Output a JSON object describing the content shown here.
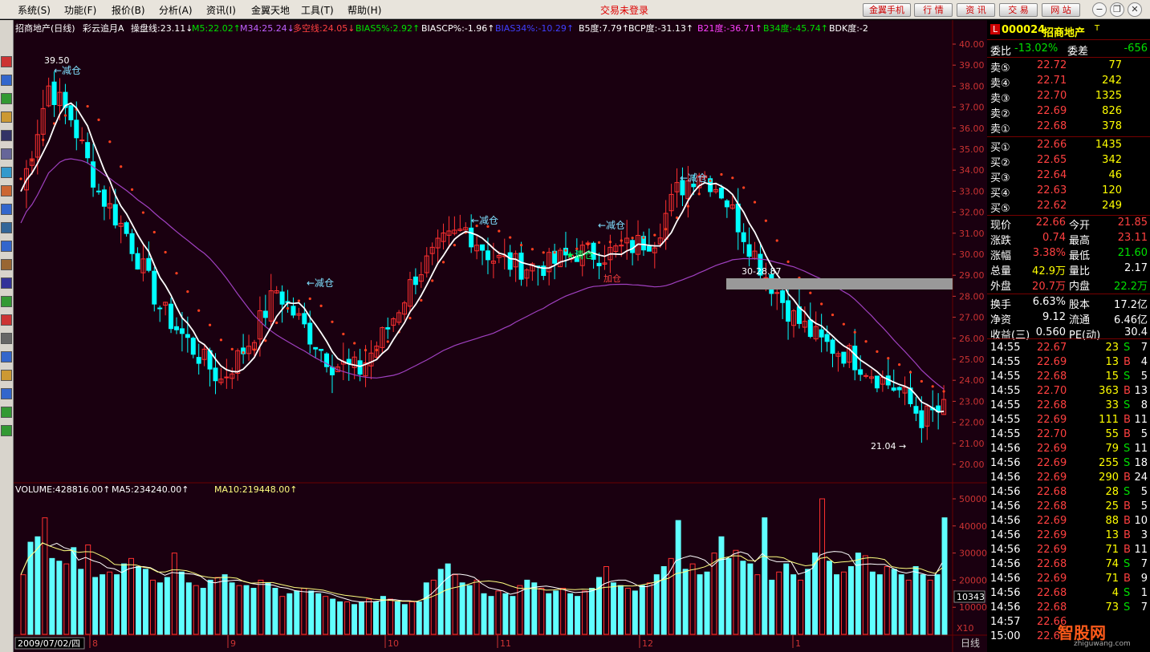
{
  "menu": [
    "系统(S)",
    "功能(F)",
    "报价(B)",
    "分析(A)",
    "资讯(I)",
    "金翼天地",
    "工具(T)",
    "帮助(H)"
  ],
  "status": "交易未登录",
  "top_buttons": [
    "金翼手机",
    "行 情",
    "资 讯",
    "交 易",
    "网 站"
  ],
  "window_buttons": [
    "minimize-icon",
    "restore-icon",
    "close-icon"
  ],
  "toolbar_icons": [
    "chart-icon",
    "grid-icon",
    "line-icon",
    "bar-icon",
    "list-icon",
    "table-icon",
    "info-icon",
    "user-icon",
    "f10-icon",
    "search-icon",
    "ie-icon",
    "draw-icon",
    "si-icon",
    "money-icon",
    "dollar-icon",
    "wrench-icon",
    "zoom-icon",
    "pencil-icon",
    "move-icon",
    "up-arrow-icon",
    "down-arrow-icon"
  ],
  "indicator_bar": [
    {
      "text": "招商地产(日线)",
      "color": "#ffffff"
    },
    {
      "text": "彩云追月A",
      "color": "#ffffff"
    },
    {
      "text": "操盘线:23.11↓",
      "color": "#ffffff"
    },
    {
      "text": "M5:22.02↑",
      "color": "#00e000"
    },
    {
      "text": "M34:25.24↓",
      "color": "#c060ff"
    },
    {
      "text": "多空线:24.05↓",
      "color": "#ff4040"
    },
    {
      "text": "BIAS5%:2.92↑",
      "color": "#00e000"
    },
    {
      "text": "BIASCP%:-1.96↑",
      "color": "#ffffff"
    },
    {
      "text": "BIAS34%:-10.29↑",
      "color": "#4040ff"
    },
    {
      "text": "B5度:7.79↑",
      "color": "#ffffff"
    },
    {
      "text": "BCP度:-31.13↑",
      "color": "#ffffff"
    },
    {
      "text": "B21度:-36.71↑",
      "color": "#ff40ff"
    },
    {
      "text": "B34度:-45.74↑",
      "color": "#00e000"
    },
    {
      "text": "BDK度:-2",
      "color": "#ffffff"
    }
  ],
  "price_labels": {
    "high": "39.50",
    "low": "21.04",
    "marker": "30-28.87",
    "reduce": "←减仓",
    "reduce_alt": "减仓",
    "clear": "清仓",
    "add": "加仓"
  },
  "volume_bar": [
    {
      "text": "VOLUME:428816.00↑",
      "color": "#ffffff"
    },
    {
      "text": "MA5:234240.00↑",
      "color": "#ffffff"
    },
    {
      "text": "MA10:219448.00↑",
      "color": "#ffff80"
    }
  ],
  "volume_marker": "10343",
  "volume_unit": "X10",
  "period": "日线",
  "date_box": "2009/07/02/四",
  "months": [
    "8",
    "9",
    "10",
    "11",
    "12",
    "1"
  ],
  "chart_data": {
    "type": "candlestick",
    "price_axis": {
      "ticks": [
        "40.00",
        "39.00",
        "38.00",
        "37.00",
        "36.00",
        "35.00",
        "34.00",
        "33.00",
        "32.00",
        "31.00",
        "30.00",
        "29.00",
        "28.00",
        "27.00",
        "26.00",
        "25.00",
        "24.00",
        "23.00",
        "22.00",
        "21.00",
        "20.00"
      ],
      "ylim": [
        20,
        40
      ]
    },
    "volume_axis": {
      "ticks": [
        "50000",
        "40000",
        "30000",
        "20000",
        "10000"
      ],
      "ylim": [
        0,
        50000
      ]
    },
    "volume_series": [
      22000,
      34000,
      36000,
      43000,
      28000,
      27000,
      26000,
      32000,
      24000,
      33000,
      21000,
      22000,
      23000,
      22000,
      26000,
      28000,
      25000,
      24000,
      20000,
      19000,
      21000,
      30000,
      23000,
      19000,
      18000,
      17000,
      20000,
      21000,
      22000,
      19000,
      18000,
      18000,
      17000,
      20000,
      19000,
      17000,
      14000,
      15000,
      16000,
      17000,
      16000,
      15000,
      14000,
      13000,
      12000,
      12000,
      11000,
      12000,
      13000,
      12000,
      14000,
      13000,
      12000,
      11000,
      12000,
      12000,
      19000,
      20000,
      24000,
      26000,
      22000,
      19000,
      18000,
      20000,
      15000,
      14000,
      16000,
      15000,
      14000,
      18000,
      20000,
      19000,
      17000,
      15000,
      16000,
      17000,
      15000,
      14000,
      16000,
      17000,
      21000,
      25000,
      19000,
      18000,
      17000,
      16000,
      18000,
      19000,
      22000,
      25000,
      28000,
      42000,
      24000,
      26000,
      22000,
      23000,
      30000,
      36000,
      28000,
      31000,
      27000,
      26000,
      22000,
      43000,
      20000,
      23000,
      26000,
      22000,
      20000,
      24000,
      30000,
      50000,
      27000,
      22000,
      23000,
      25000,
      30000,
      29000,
      23000,
      22000,
      25000,
      24000,
      22000,
      20000,
      25000,
      22000,
      20000,
      22000,
      43000
    ]
  },
  "quote": {
    "code": "000024",
    "name": "招商地产",
    "flag": "L",
    "tag": "T",
    "weibi_label": "委比",
    "weibi": "-13.02%",
    "weicha_label": "委差",
    "weicha": "-656",
    "asks": [
      {
        "label": "卖⑤",
        "price": "22.72",
        "vol": "77"
      },
      {
        "label": "卖④",
        "price": "22.71",
        "vol": "242"
      },
      {
        "label": "卖③",
        "price": "22.70",
        "vol": "1325"
      },
      {
        "label": "卖②",
        "price": "22.69",
        "vol": "826"
      },
      {
        "label": "卖①",
        "price": "22.68",
        "vol": "378"
      }
    ],
    "bids": [
      {
        "label": "买①",
        "price": "22.66",
        "vol": "1435"
      },
      {
        "label": "买②",
        "price": "22.65",
        "vol": "342"
      },
      {
        "label": "买③",
        "price": "22.64",
        "vol": "46"
      },
      {
        "label": "买④",
        "price": "22.63",
        "vol": "120"
      },
      {
        "label": "买⑤",
        "price": "22.62",
        "vol": "249"
      }
    ],
    "stats": [
      {
        "l1": "现价",
        "v1": "22.66",
        "c1": "#ff4040",
        "l2": "今开",
        "v2": "21.85",
        "c2": "#ff4040"
      },
      {
        "l1": "涨跌",
        "v1": "0.74",
        "c1": "#ff4040",
        "l2": "最高",
        "v2": "23.11",
        "c2": "#ff4040"
      },
      {
        "l1": "涨幅",
        "v1": "3.38%",
        "c1": "#ff4040",
        "l2": "最低",
        "v2": "21.60",
        "c2": "#00e000"
      },
      {
        "l1": "总量",
        "v1": "42.9万",
        "c1": "#ffff00",
        "l2": "量比",
        "v2": "2.17",
        "c2": "#ffffff"
      },
      {
        "l1": "外盘",
        "v1": "20.7万",
        "c1": "#ff4040",
        "l2": "内盘",
        "v2": "22.2万",
        "c2": "#00e000"
      },
      {
        "l1": "换手",
        "v1": "6.63%",
        "c1": "#ffffff",
        "l2": "股本",
        "v2": "17.2亿",
        "c2": "#ffffff"
      },
      {
        "l1": "净资",
        "v1": "9.12",
        "c1": "#ffffff",
        "l2": "流通",
        "v2": "6.46亿",
        "c2": "#ffffff"
      },
      {
        "l1": "收益(三)",
        "v1": "0.560",
        "c1": "#ffffff",
        "l2": "PE(动)",
        "v2": "30.4",
        "c2": "#ffffff"
      }
    ],
    "ticks": [
      {
        "t": "14:55",
        "p": "22.67",
        "v": "23",
        "s": "S",
        "n": "7"
      },
      {
        "t": "14:55",
        "p": "22.69",
        "v": "13",
        "s": "B",
        "n": "4"
      },
      {
        "t": "14:55",
        "p": "22.68",
        "v": "15",
        "s": "S",
        "n": "5"
      },
      {
        "t": "14:55",
        "p": "22.70",
        "v": "363",
        "s": "B",
        "n": "13"
      },
      {
        "t": "14:55",
        "p": "22.68",
        "v": "33",
        "s": "S",
        "n": "8"
      },
      {
        "t": "14:55",
        "p": "22.69",
        "v": "111",
        "s": "B",
        "n": "11"
      },
      {
        "t": "14:55",
        "p": "22.70",
        "v": "55",
        "s": "B",
        "n": "5"
      },
      {
        "t": "14:56",
        "p": "22.69",
        "v": "79",
        "s": "S",
        "n": "11"
      },
      {
        "t": "14:56",
        "p": "22.69",
        "v": "255",
        "s": "S",
        "n": "18"
      },
      {
        "t": "14:56",
        "p": "22.69",
        "v": "290",
        "s": "B",
        "n": "24"
      },
      {
        "t": "14:56",
        "p": "22.68",
        "v": "28",
        "s": "S",
        "n": "5"
      },
      {
        "t": "14:56",
        "p": "22.68",
        "v": "25",
        "s": "B",
        "n": "5"
      },
      {
        "t": "14:56",
        "p": "22.69",
        "v": "88",
        "s": "B",
        "n": "10"
      },
      {
        "t": "14:56",
        "p": "22.69",
        "v": "13",
        "s": "B",
        "n": "3"
      },
      {
        "t": "14:56",
        "p": "22.69",
        "v": "71",
        "s": "B",
        "n": "11"
      },
      {
        "t": "14:56",
        "p": "22.68",
        "v": "74",
        "s": "S",
        "n": "7"
      },
      {
        "t": "14:56",
        "p": "22.69",
        "v": "71",
        "s": "B",
        "n": "9"
      },
      {
        "t": "14:56",
        "p": "22.68",
        "v": "4",
        "s": "S",
        "n": "1"
      },
      {
        "t": "14:56",
        "p": "22.68",
        "v": "73",
        "s": "S",
        "n": "7"
      },
      {
        "t": "14:57",
        "p": "22.66",
        "v": "",
        "s": "",
        "n": ""
      },
      {
        "t": "15:00",
        "p": "22.6",
        "v": "",
        "s": "",
        "n": ""
      }
    ]
  },
  "watermark": {
    "text": "智股网",
    "sub": "zhiguwang.com"
  },
  "colors": {
    "up": "#ff3030",
    "down": "#00ffff",
    "bg": "#1a0010",
    "grid": "#6a0000"
  }
}
